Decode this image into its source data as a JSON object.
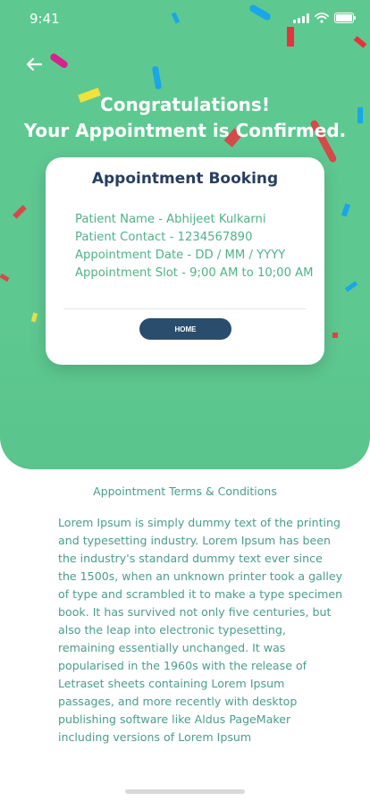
{
  "status_bar": {
    "time": "9:41",
    "icons": [
      "signal-icon",
      "wifi-icon",
      "battery-icon"
    ]
  },
  "header": {
    "back_icon": "arrow-left-icon",
    "headline_line1": "Congratulations!",
    "headline_line2": "Your Appointment is Confirmed."
  },
  "card": {
    "title": "Appointment Booking",
    "details": [
      "Patient Name - Abhijeet Kulkarni",
      "Patient Contact - 1234567890",
      "Appointment Date - DD / MM / YYYY",
      "Appointment Slot - 9;00 AM to 10;00 AM"
    ],
    "home_button": "HOME"
  },
  "terms": {
    "title": "Appointment Terms & Conditions",
    "body": "Lorem Ipsum is simply dummy text of the printing and typesetting industry. Lorem Ipsum has been the industry's standard dummy text ever since the 1500s, when an unknown printer took a galley of type and scrambled it to make a type specimen book. It has survived not only five centuries, but also the leap into electronic typesetting, remaining essentially unchanged. It was popularised in the 1960s with the release of Letraset sheets containing Lorem Ipsum passages, and more recently with desktop publishing software like Aldus PageMaker including versions of Lorem Ipsum"
  },
  "colors": {
    "hero_background": "#5ec891",
    "card_title": "#273e5f",
    "detail_text": "#4fb289",
    "button_background": "#2a4d6d",
    "terms_text": "#4b9c8e"
  }
}
